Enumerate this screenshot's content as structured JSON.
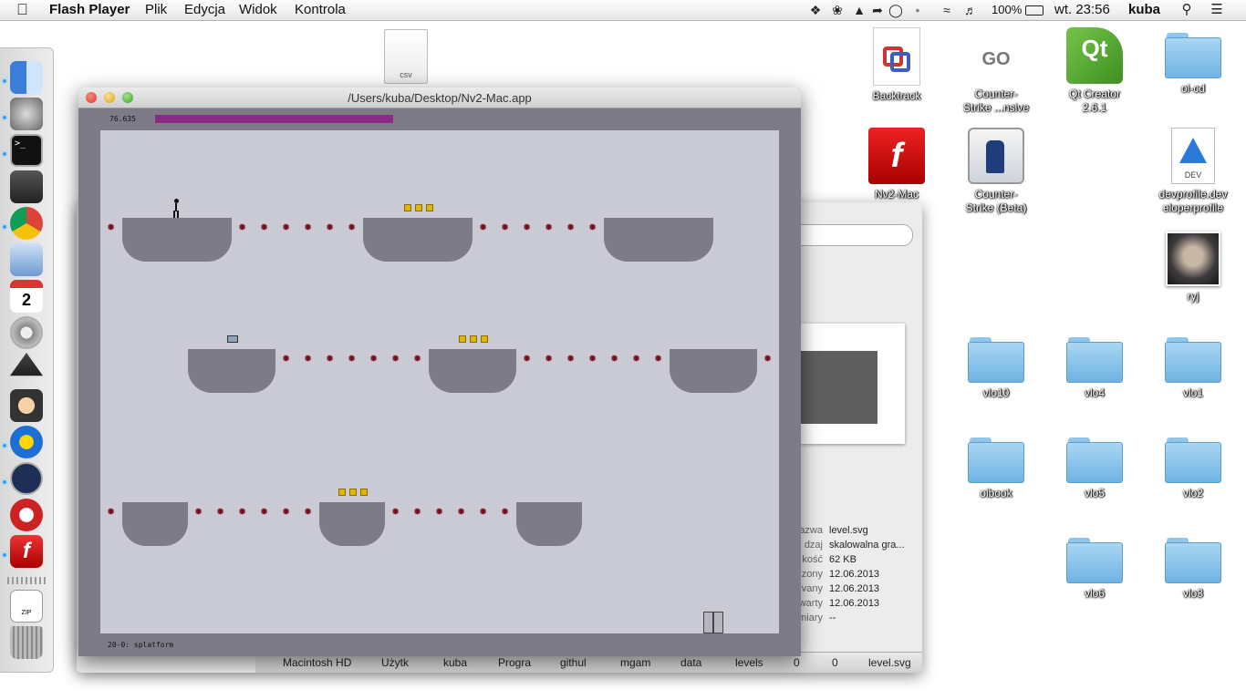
{
  "menubar": {
    "app_name": "Flash Player",
    "menus": [
      "Plik",
      "Edycja",
      "Widok",
      "Kontrola"
    ],
    "battery": "100%",
    "clock": "wt. 23:56",
    "user": "kuba"
  },
  "player_window": {
    "title": "/Users/kuba/Desktop/Nv2-Mac.app",
    "time_value": "76.635",
    "time_fraction": 0.58,
    "level_name": "20-0: splatform"
  },
  "desktop": {
    "file_icon": {
      "ext": "csv"
    },
    "icons": [
      {
        "label": "Backtrack"
      },
      {
        "label": "Counter-\nStrike ...nsive"
      },
      {
        "label": "Qt Creator\n2.6.1"
      },
      {
        "label": "oi-cd"
      },
      {
        "label": "Nv2-Mac"
      },
      {
        "label": "Counter-\nStrike (Beta)"
      },
      {
        "label": "devprofile.dev\neloperprofile"
      },
      {
        "label": "ryj"
      },
      {
        "label": "vlo10"
      },
      {
        "label": "vlo4"
      },
      {
        "label": "vlo1"
      },
      {
        "label": "oibook"
      },
      {
        "label": "vlo5"
      },
      {
        "label": "vlo2"
      },
      {
        "label": "vlo6"
      },
      {
        "label": "vlo3"
      }
    ],
    "icon_texts": {
      "go": "GO",
      "qt": "Qt",
      "dev": "DEV",
      "zip": "ZIP",
      "cal_day": "2"
    }
  },
  "finder": {
    "info": [
      {
        "key": "azwa",
        "value": "level.svg"
      },
      {
        "key": "dzaj",
        "value": "skalowalna gra..."
      },
      {
        "key": "kość",
        "value": "62 KB"
      },
      {
        "key": "zony",
        "value": "12.06.2013"
      },
      {
        "key": "vany",
        "value": "12.06.2013"
      },
      {
        "key": "warty",
        "value": "12.06.2013"
      },
      {
        "key": "miary",
        "value": "--"
      }
    ],
    "path": [
      "Macintosh HD",
      "Użytk",
      "kuba",
      "Progra",
      "githul",
      "mgam",
      "data",
      "levels",
      "0",
      "0",
      "level.svg"
    ]
  }
}
